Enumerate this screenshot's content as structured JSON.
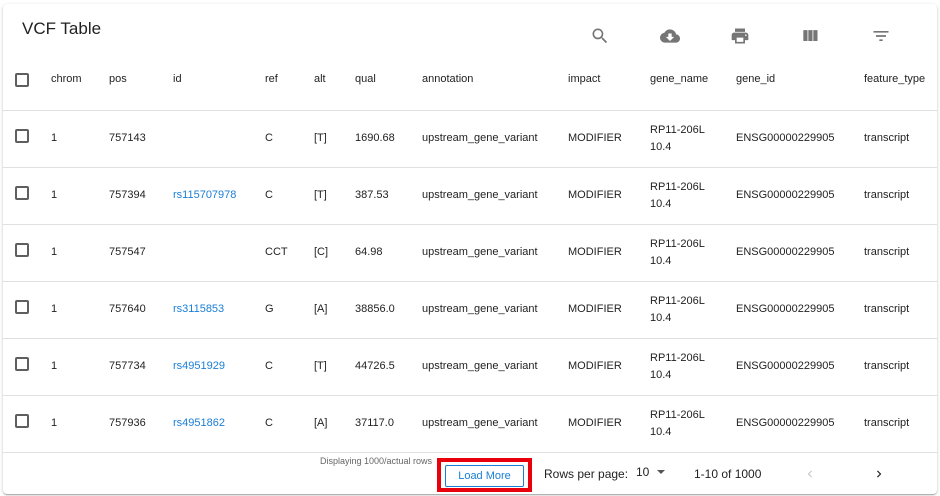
{
  "header": {
    "title": "VCF Table",
    "icons": [
      "search-icon",
      "cloud-download-icon",
      "print-icon",
      "view-columns-icon",
      "filter-list-icon"
    ]
  },
  "table": {
    "columns": [
      "chrom",
      "pos",
      "id",
      "ref",
      "alt",
      "qual",
      "annotation",
      "impact",
      "gene_name",
      "gene_id",
      "feature_type"
    ],
    "rows": [
      {
        "chrom": "1",
        "pos": "757143",
        "id": "",
        "ref": "C",
        "alt": "[T]",
        "qual": "1690.68",
        "annotation": "upstream_gene_variant",
        "impact": "MODIFIER",
        "gene_name": "RP11-206L10.4",
        "gene_id": "ENSG00000229905",
        "feature_type": "transcript"
      },
      {
        "chrom": "1",
        "pos": "757394",
        "id": "rs115707978",
        "ref": "C",
        "alt": "[T]",
        "qual": "387.53",
        "annotation": "upstream_gene_variant",
        "impact": "MODIFIER",
        "gene_name": "RP11-206L10.4",
        "gene_id": "ENSG00000229905",
        "feature_type": "transcript"
      },
      {
        "chrom": "1",
        "pos": "757547",
        "id": "",
        "ref": "CCT",
        "alt": "[C]",
        "qual": "64.98",
        "annotation": "upstream_gene_variant",
        "impact": "MODIFIER",
        "gene_name": "RP11-206L10.4",
        "gene_id": "ENSG00000229905",
        "feature_type": "transcript"
      },
      {
        "chrom": "1",
        "pos": "757640",
        "id": "rs3115853",
        "ref": "G",
        "alt": "[A]",
        "qual": "38856.0",
        "annotation": "upstream_gene_variant",
        "impact": "MODIFIER",
        "gene_name": "RP11-206L10.4",
        "gene_id": "ENSG00000229905",
        "feature_type": "transcript"
      },
      {
        "chrom": "1",
        "pos": "757734",
        "id": "rs4951929",
        "ref": "C",
        "alt": "[T]",
        "qual": "44726.5",
        "annotation": "upstream_gene_variant",
        "impact": "MODIFIER",
        "gene_name": "RP11-206L10.4",
        "gene_id": "ENSG00000229905",
        "feature_type": "transcript"
      },
      {
        "chrom": "1",
        "pos": "757936",
        "id": "rs4951862",
        "ref": "C",
        "alt": "[A]",
        "qual": "37117.0",
        "annotation": "upstream_gene_variant",
        "impact": "MODIFIER",
        "gene_name": "RP11-206L10.4",
        "gene_id": "ENSG00000229905",
        "feature_type": "transcript"
      }
    ]
  },
  "footer": {
    "displaying": "Displaying 1000/actual rows",
    "load_more": "Load More",
    "rows_per_page_label": "Rows per page:",
    "rows_per_page_value": "10",
    "range": "1-10 of 1000"
  },
  "colors": {
    "link": "#1a7ed6",
    "highlight_box": "#e8000d",
    "icon": "#757575"
  }
}
